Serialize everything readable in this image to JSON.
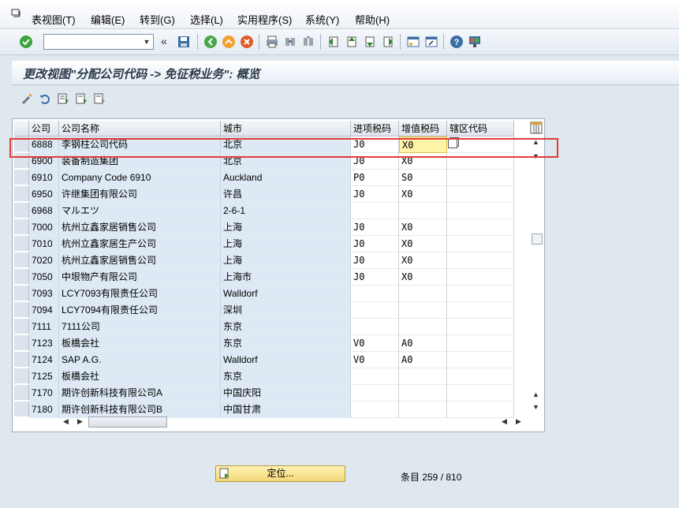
{
  "menubar": {
    "items": [
      "表视图(T)",
      "编辑(E)",
      "转到(G)",
      "选择(L)",
      "实用程序(S)",
      "系统(Y)",
      "帮助(H)"
    ]
  },
  "toolbar": {
    "command_value": "",
    "icons": [
      "enter-icon",
      "save-icon",
      "back-icon",
      "exit-icon",
      "cancel-icon",
      "print-icon",
      "find-icon",
      "find-next-icon",
      "first-page-icon",
      "prev-page-icon",
      "next-page-icon",
      "last-page-icon",
      "new-session-icon",
      "shortcut-icon",
      "help-icon",
      "customize-layout-icon"
    ]
  },
  "screen": {
    "title": "更改视图\"分配公司代码 -> 免征税业务\": 概览"
  },
  "table": {
    "columns": [
      "公司",
      "公司名称",
      "城市",
      "进项税码",
      "增值税码",
      "辖区代码"
    ],
    "rows": [
      {
        "code": "6888",
        "name": "李钢柱公司代码",
        "city": "北京",
        "input": "J0",
        "vat": "X0",
        "jur": ""
      },
      {
        "code": "6900",
        "name": "装备制造集团",
        "city": "北京",
        "input": "J0",
        "vat": "X0",
        "jur": ""
      },
      {
        "code": "6910",
        "name": "Company Code 6910",
        "city": "Auckland",
        "input": "P0",
        "vat": "S0",
        "jur": ""
      },
      {
        "code": "6950",
        "name": "许继集团有限公司",
        "city": "许昌",
        "input": "J0",
        "vat": "X0",
        "jur": ""
      },
      {
        "code": "6968",
        "name": "マルエツ",
        "city": "2-6-1",
        "input": "",
        "vat": "",
        "jur": ""
      },
      {
        "code": "7000",
        "name": "杭州立鑫家居销售公司",
        "city": "上海",
        "input": "J0",
        "vat": "X0",
        "jur": ""
      },
      {
        "code": "7010",
        "name": "杭州立鑫家居生产公司",
        "city": "上海",
        "input": "J0",
        "vat": "X0",
        "jur": ""
      },
      {
        "code": "7020",
        "name": "杭州立鑫家居销售公司",
        "city": "上海",
        "input": "J0",
        "vat": "X0",
        "jur": ""
      },
      {
        "code": "7050",
        "name": "中垠物产有限公司",
        "city": "上海市",
        "input": "J0",
        "vat": "X0",
        "jur": ""
      },
      {
        "code": "7093",
        "name": "LCY7093有限责任公司",
        "city": "Walldorf",
        "input": "",
        "vat": "",
        "jur": ""
      },
      {
        "code": "7094",
        "name": "LCY7094有限责任公司",
        "city": "深圳",
        "input": "",
        "vat": "",
        "jur": ""
      },
      {
        "code": "7111",
        "name": "7111公司",
        "city": "东京",
        "input": "",
        "vat": "",
        "jur": ""
      },
      {
        "code": "7123",
        "name": "板橋会社",
        "city": "东京",
        "input": "V0",
        "vat": "A0",
        "jur": ""
      },
      {
        "code": "7124",
        "name": "SAP A.G.",
        "city": "Walldorf",
        "input": "V0",
        "vat": "A0",
        "jur": ""
      },
      {
        "code": "7125",
        "name": "板橋会社",
        "city": "东京",
        "input": "",
        "vat": "",
        "jur": ""
      },
      {
        "code": "7170",
        "name": "期许创新科技有限公司A",
        "city": "中国庆阳",
        "input": "",
        "vat": "",
        "jur": ""
      },
      {
        "code": "7180",
        "name": "期许创新科技有限公司B",
        "city": "中国甘肃",
        "input": "",
        "vat": "",
        "jur": ""
      }
    ]
  },
  "footer": {
    "position_button": "定位...",
    "entries_text": "条目 259 / 810"
  },
  "colors": {
    "highlight": "#e23b3b",
    "active_field": "#fff4a8",
    "key_column": "#dde9f4"
  }
}
